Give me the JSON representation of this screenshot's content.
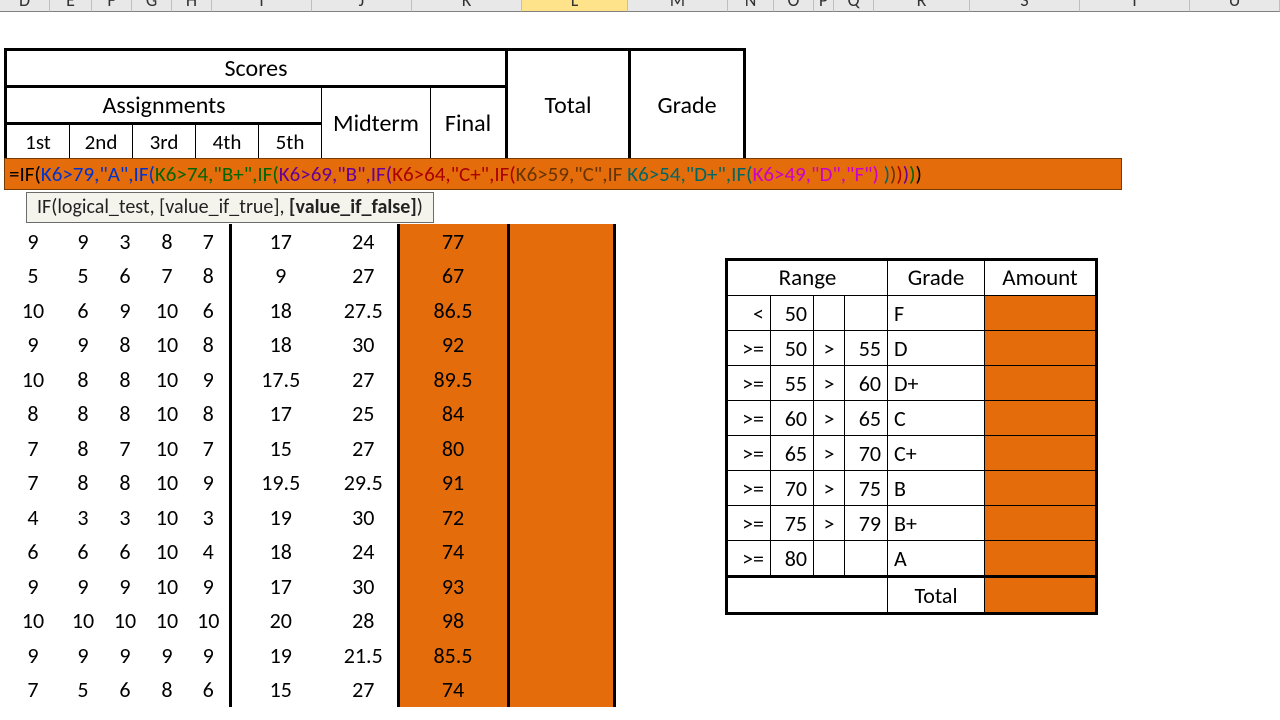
{
  "columns": [
    {
      "label": "D",
      "w": 50
    },
    {
      "label": "E",
      "w": 42
    },
    {
      "label": "F",
      "w": 40
    },
    {
      "label": "G",
      "w": 40
    },
    {
      "label": "H",
      "w": 40
    },
    {
      "label": "I",
      "w": 100
    },
    {
      "label": "J",
      "w": 100
    },
    {
      "label": "K",
      "w": 110
    },
    {
      "label": "L",
      "w": 106,
      "selected": true
    },
    {
      "label": "M",
      "w": 100
    },
    {
      "label": "N",
      "w": 46
    },
    {
      "label": "O",
      "w": 40
    },
    {
      "label": "P",
      "w": 20
    },
    {
      "label": "Q",
      "w": 40
    },
    {
      "label": "R",
      "w": 96
    },
    {
      "label": "S",
      "w": 110
    },
    {
      "label": "T",
      "w": 110
    },
    {
      "label": "U",
      "w": 90
    }
  ],
  "headers": {
    "scores": "Scores",
    "assignments": "Assignments",
    "midterm": "Midterm",
    "final": "Final",
    "total": "Total",
    "grade": "Grade",
    "a1": "1st",
    "a2": "2nd",
    "a3": "3rd",
    "a4": "4th",
    "a5": "5th"
  },
  "formula": {
    "text_plain": "=IF(K6>79,\"A\",IF(K6>74,\"B+\",IF(K6>69,\"B\",IF(K6>64,\"C+\",IF(K6>59,\"C\",IF K6>54,\"D+\",IF(K6>49,\"D\",\"F\") )))))",
    "segments": [
      {
        "t": "=IF",
        "c": "f-black"
      },
      {
        "t": "(",
        "c": "f-black"
      },
      {
        "t": "K6>79,\"A\",IF",
        "c": "f-blue"
      },
      {
        "t": "(",
        "c": "f-blue"
      },
      {
        "t": "K6>74,\"B+\",IF",
        "c": "f-green"
      },
      {
        "t": "(",
        "c": "f-green"
      },
      {
        "t": "K6>69,\"B\",IF",
        "c": "f-purple"
      },
      {
        "t": "(",
        "c": "f-purple"
      },
      {
        "t": "K6>64,\"C+\",IF",
        "c": "f-red"
      },
      {
        "t": "(",
        "c": "f-red"
      },
      {
        "t": "K6>59,\"C\",IF",
        "c": "f-brown"
      },
      {
        "t": " ",
        "c": "f-brown"
      },
      {
        "t": "K6>54,\"D+\",IF",
        "c": "f-teal"
      },
      {
        "t": "(",
        "c": "f-teal"
      },
      {
        "t": "K6>49,\"D\",\"F\"",
        "c": "f-fuchsia"
      },
      {
        "t": ")",
        "c": "f-fuchsia"
      },
      {
        "t": " )",
        "c": "f-teal"
      },
      {
        "t": ")",
        "c": "f-brown"
      },
      {
        "t": ")",
        "c": "f-red"
      },
      {
        "t": ")",
        "c": "f-purple"
      },
      {
        "t": ")",
        "c": "f-green"
      },
      {
        "t": ")",
        "c": "f-black"
      }
    ]
  },
  "tooltip": {
    "fn": "IF",
    "arg1": "logical_test",
    "arg2": "[value_if_true]",
    "arg3": "[value_if_false]"
  },
  "rows": [
    {
      "a": [
        9,
        9,
        3,
        8,
        7
      ],
      "mid": 17,
      "fin": 24,
      "tot": 77
    },
    {
      "a": [
        5,
        5,
        6,
        7,
        8
      ],
      "mid": 9,
      "fin": 27,
      "tot": 67
    },
    {
      "a": [
        10,
        6,
        9,
        10,
        6
      ],
      "mid": 18,
      "fin": 27.5,
      "tot": 86.5
    },
    {
      "a": [
        9,
        9,
        8,
        10,
        8
      ],
      "mid": 18,
      "fin": 30,
      "tot": 92
    },
    {
      "a": [
        10,
        8,
        8,
        10,
        9
      ],
      "mid": 17.5,
      "fin": 27,
      "tot": 89.5
    },
    {
      "a": [
        8,
        8,
        8,
        10,
        8
      ],
      "mid": 17,
      "fin": 25,
      "tot": 84
    },
    {
      "a": [
        7,
        8,
        7,
        10,
        7
      ],
      "mid": 15,
      "fin": 27,
      "tot": 80
    },
    {
      "a": [
        7,
        8,
        8,
        10,
        9
      ],
      "mid": 19.5,
      "fin": 29.5,
      "tot": 91
    },
    {
      "a": [
        4,
        3,
        3,
        10,
        3
      ],
      "mid": 19,
      "fin": 30,
      "tot": 72
    },
    {
      "a": [
        6,
        6,
        6,
        10,
        4
      ],
      "mid": 18,
      "fin": 24,
      "tot": 74
    },
    {
      "a": [
        9,
        9,
        9,
        10,
        9
      ],
      "mid": 17,
      "fin": 30,
      "tot": 93
    },
    {
      "a": [
        10,
        10,
        10,
        10,
        10
      ],
      "mid": 20,
      "fin": 28,
      "tot": 98
    },
    {
      "a": [
        9,
        9,
        9,
        9,
        9
      ],
      "mid": 19,
      "fin": 21.5,
      "tot": 85.5
    },
    {
      "a": [
        7,
        5,
        6,
        8,
        6
      ],
      "mid": 15,
      "fin": 27,
      "tot": 74
    }
  ],
  "grid_widths": {
    "a": 42,
    "i": 100,
    "j": 68,
    "k": 110,
    "l": 106
  },
  "lookup": {
    "h_range": "Range",
    "h_grade": "Grade",
    "h_amount": "Amount",
    "total_label": "Total",
    "rows": [
      {
        "op1": "<",
        "lo": "50",
        "op2": "",
        "hi": "",
        "g": "F"
      },
      {
        "op1": ">=",
        "lo": "50",
        "op2": ">",
        "hi": "55",
        "g": "D"
      },
      {
        "op1": ">=",
        "lo": "55",
        "op2": ">",
        "hi": "60",
        "g": "D+"
      },
      {
        "op1": ">=",
        "lo": "60",
        "op2": ">",
        "hi": "65",
        "g": "C"
      },
      {
        "op1": ">=",
        "lo": "65",
        "op2": ">",
        "hi": "70",
        "g": "C+"
      },
      {
        "op1": ">=",
        "lo": "70",
        "op2": ">",
        "hi": "75",
        "g": "B"
      },
      {
        "op1": ">=",
        "lo": "75",
        "op2": ">",
        "hi": "79",
        "g": "B+"
      },
      {
        "op1": ">=",
        "lo": "80",
        "op2": "",
        "hi": "",
        "g": "A"
      }
    ]
  },
  "chart_data": {
    "type": "table",
    "title": "Student scores with nested IF grade formula",
    "columns": [
      "1st",
      "2nd",
      "3rd",
      "4th",
      "5th",
      "Midterm",
      "Final",
      "Total"
    ],
    "rows": [
      [
        9,
        9,
        3,
        8,
        7,
        17,
        24,
        77
      ],
      [
        5,
        5,
        6,
        7,
        8,
        9,
        27,
        67
      ],
      [
        10,
        6,
        9,
        10,
        6,
        18,
        27.5,
        86.5
      ],
      [
        9,
        9,
        8,
        10,
        8,
        18,
        30,
        92
      ],
      [
        10,
        8,
        8,
        10,
        9,
        17.5,
        27,
        89.5
      ],
      [
        8,
        8,
        8,
        10,
        8,
        17,
        25,
        84
      ],
      [
        7,
        8,
        7,
        10,
        7,
        15,
        27,
        80
      ],
      [
        7,
        8,
        8,
        10,
        9,
        19.5,
        29.5,
        91
      ],
      [
        4,
        3,
        3,
        10,
        3,
        19,
        30,
        72
      ],
      [
        6,
        6,
        6,
        10,
        4,
        18,
        24,
        74
      ],
      [
        9,
        9,
        9,
        10,
        9,
        17,
        30,
        93
      ],
      [
        10,
        10,
        10,
        10,
        10,
        20,
        28,
        98
      ],
      [
        9,
        9,
        9,
        9,
        9,
        19,
        21.5,
        85.5
      ],
      [
        7,
        5,
        6,
        8,
        6,
        15,
        27,
        74
      ]
    ],
    "grade_lookup": [
      {
        "min": null,
        "max": 50,
        "grade": "F"
      },
      {
        "min": 50,
        "max": 55,
        "grade": "D"
      },
      {
        "min": 55,
        "max": 60,
        "grade": "D+"
      },
      {
        "min": 60,
        "max": 65,
        "grade": "C"
      },
      {
        "min": 65,
        "max": 70,
        "grade": "C+"
      },
      {
        "min": 70,
        "max": 75,
        "grade": "B"
      },
      {
        "min": 75,
        "max": 79,
        "grade": "B+"
      },
      {
        "min": 80,
        "max": null,
        "grade": "A"
      }
    ]
  }
}
